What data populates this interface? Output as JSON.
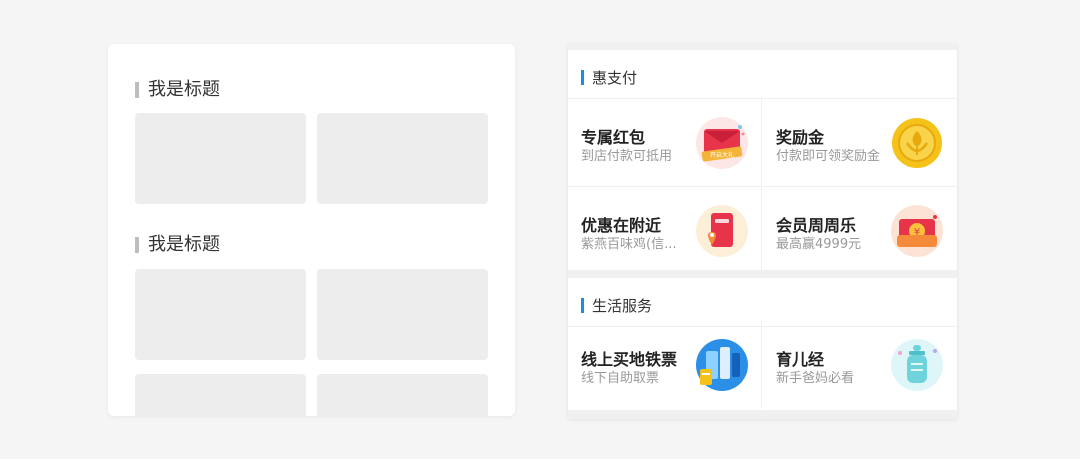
{
  "wireframe": {
    "titles": [
      "我是标题",
      "我是标题"
    ]
  },
  "sections": [
    {
      "title": "惠支付",
      "items": [
        {
          "name": "专属红包",
          "desc": "到店付款可抵用",
          "icon": "red-envelope-icon",
          "icon_badge": "开启大礼"
        },
        {
          "name": "奖励金",
          "desc": "付款即可领奖励金",
          "icon": "gold-coin-icon"
        },
        {
          "name": "优惠在附近",
          "desc": "紫燕百味鸡(信...",
          "icon": "nearby-coupon-icon"
        },
        {
          "name": "会员周周乐",
          "desc": "最高赢4999元",
          "icon": "lucky-envelope-icon"
        }
      ]
    },
    {
      "title": "生活服务",
      "items": [
        {
          "name": "线上买地铁票",
          "desc": "线下自助取票",
          "icon": "subway-ticket-icon"
        },
        {
          "name": "育儿经",
          "desc": "新手爸妈必看",
          "icon": "baby-bottle-icon"
        }
      ]
    }
  ],
  "colors": {
    "accent": "#1a8fe0",
    "red": "#e8344a",
    "gold": "#f5c21a",
    "blue": "#2b8fe8",
    "teal": "#6fd3dc"
  }
}
